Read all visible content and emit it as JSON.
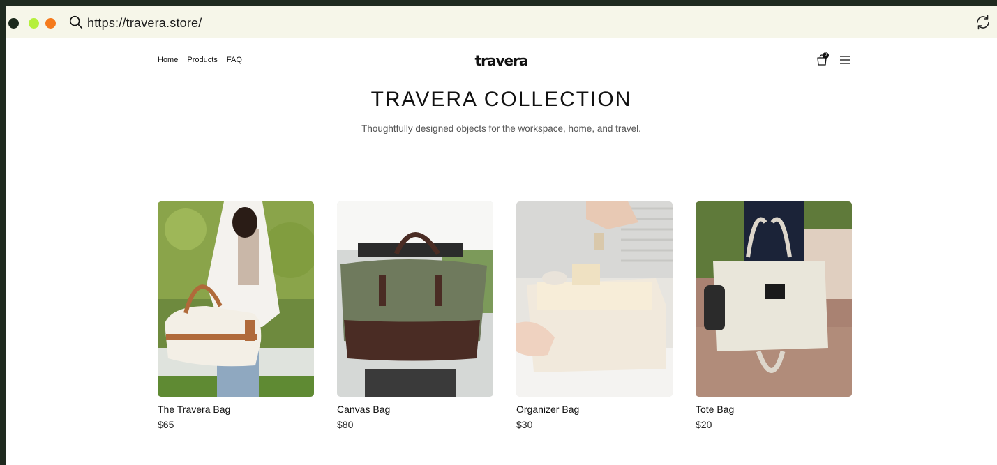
{
  "browser": {
    "url": "https://travera.store/",
    "dots": [
      "#1c2a1c",
      "#b5f03c",
      "#f57a1c"
    ]
  },
  "header": {
    "nav": [
      "Home",
      "Products",
      "FAQ"
    ],
    "logo": "travera",
    "cart_count": "0"
  },
  "hero": {
    "title": "TRAVERA COLLECTION",
    "subtitle": "Thoughtfully designed objects for the workspace, home, and travel."
  },
  "products": [
    {
      "name": "The Travera Bag",
      "price": "$65",
      "image": "woman-holding-cream-duffel-bag"
    },
    {
      "name": "Canvas Bag",
      "price": "$80",
      "image": "man-holding-olive-canvas-duffel"
    },
    {
      "name": "Organizer Bag",
      "price": "$30",
      "image": "hands-with-cream-organizer-bag"
    },
    {
      "name": "Tote Bag",
      "price": "$20",
      "image": "hand-holding-cream-tote-bag"
    }
  ]
}
